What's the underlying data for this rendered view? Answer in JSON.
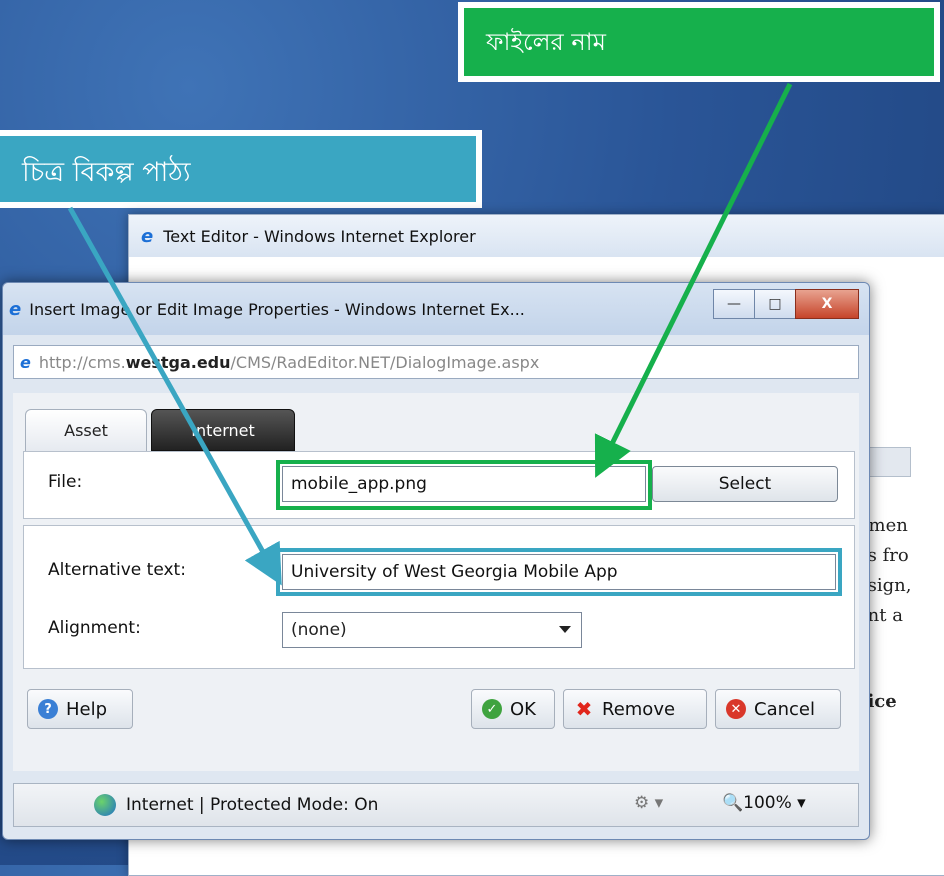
{
  "callouts": {
    "file_name": "ফাইলের নাম",
    "alt_text": "চিত্র বিকল্প পাঠ্য"
  },
  "back_window": {
    "title": "Text Editor - Windows Internet Explorer",
    "fragments": [
      "pmen",
      "es fro",
      "esign,",
      "ent a",
      "vice"
    ]
  },
  "dialog": {
    "title": "Insert Image or Edit Image Properties - Windows Internet Ex...",
    "window_buttons": {
      "minimize": "—",
      "maximize": "□",
      "close": "X"
    },
    "address": {
      "prefix": "http://cms.",
      "domain": "westga.edu",
      "path": "/CMS/RadEditor.NET/DialogImage.aspx"
    },
    "tabs": [
      "Asset",
      "Internet"
    ],
    "file": {
      "label": "File:",
      "value": "mobile_app.png",
      "select_label": "Select"
    },
    "alt_text": {
      "label": "Alternative text:",
      "value": "University of West Georgia Mobile App"
    },
    "alignment": {
      "label": "Alignment:",
      "value": "(none)"
    },
    "buttons": {
      "help": "Help",
      "ok": "OK",
      "remove": "Remove",
      "cancel": "Cancel"
    },
    "status": {
      "mode": "Internet | Protected Mode: On",
      "zoom": "100%"
    }
  },
  "colors": {
    "green_callout": "#16b04c",
    "teal_callout": "#3aa6c2"
  }
}
